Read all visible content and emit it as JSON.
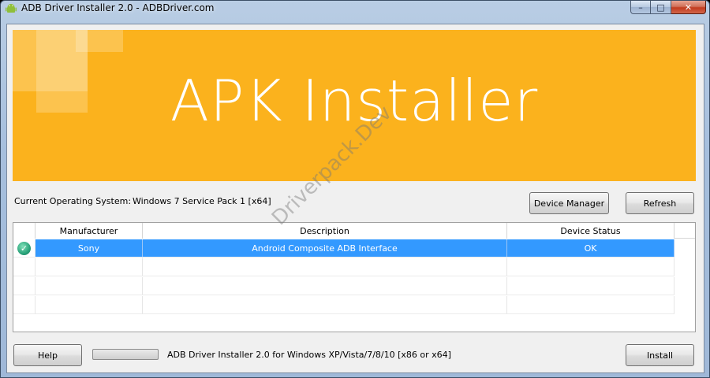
{
  "window": {
    "title": "ADB Driver Installer 2.0 - ADBDriver.com",
    "app_icon": "android-icon",
    "controls": {
      "minimize": "–",
      "maximize": "□",
      "close": "✕"
    }
  },
  "banner": {
    "title": "APK Installer",
    "background_color": "#fbb21d"
  },
  "system": {
    "os_label": "Current Operating System:",
    "os_value": "Windows 7 Service Pack 1 [x64]"
  },
  "buttons": {
    "device_manager": "Device Manager",
    "refresh": "Refresh",
    "help": "Help",
    "install": "Install"
  },
  "grid": {
    "columns": [
      "Manufacturer",
      "Description",
      "Device Status"
    ],
    "rows": [
      {
        "checked": true,
        "manufacturer": "Sony",
        "description": "Android Composite ADB Interface",
        "status": "OK",
        "selected": true
      }
    ],
    "selection_color": "#3399ff"
  },
  "footer": {
    "progress_fraction": 0,
    "status_text": "ADB Driver Installer 2.0 for Windows XP/Vista/7/8/10 [x86 or x64]"
  },
  "watermark": "Driverpack.Dev"
}
